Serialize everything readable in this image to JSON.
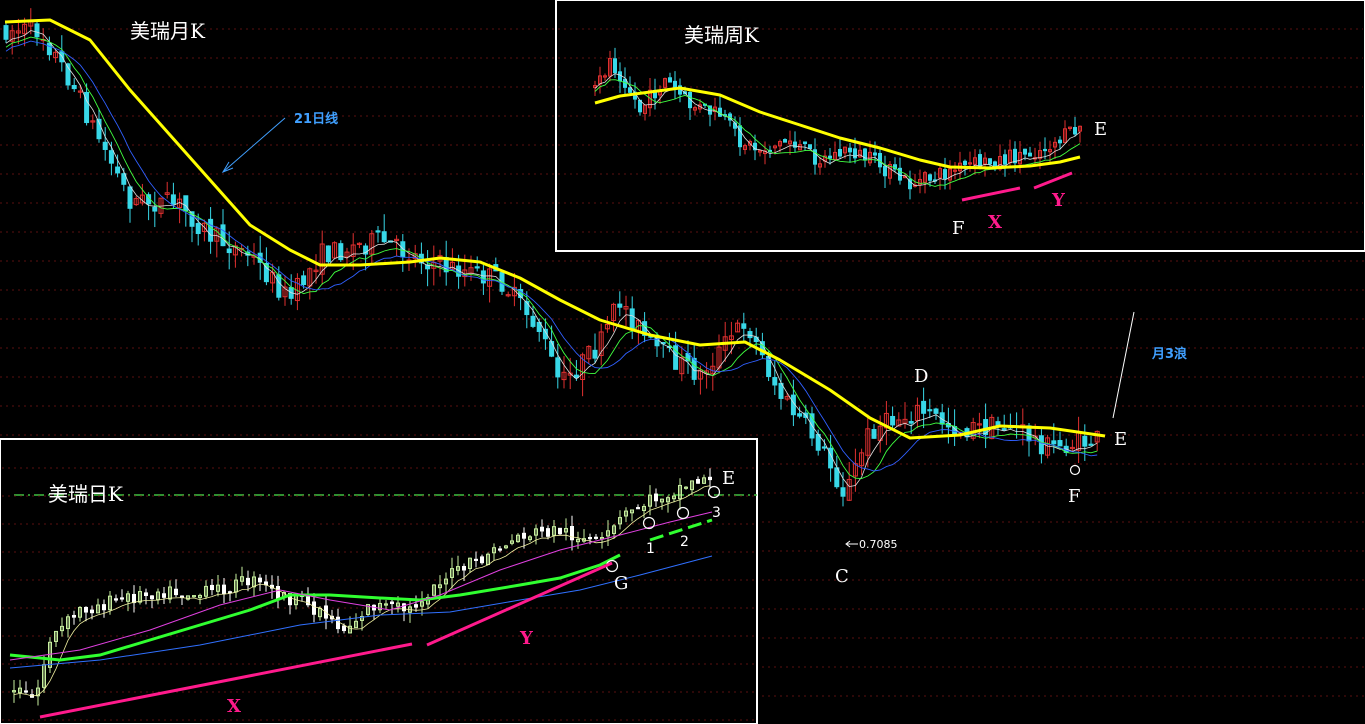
{
  "colors": {
    "background": "#000000",
    "grid": "#5a1010",
    "up": "#e03030",
    "down": "#38d8e8",
    "ma21": "#ffff00",
    "ma_fast": "#40ff40",
    "ma_mid": "#3060ff",
    "ma_white": "#e0e0e0",
    "daily_up": "#c8f0a0",
    "daily_ma_green": "#30ff30",
    "daily_ma_magenta": "#e040e0",
    "daily_ma_blue": "#3070ff",
    "trend_magenta": "#ff1a8c",
    "annotation_blue": "#40a0ff",
    "label_white": "#ffffff"
  },
  "chart_data": [
    {
      "type": "candlestick",
      "title": "美瑞月K",
      "series": [
        {
          "name": "21日线",
          "note": "21-period moving average (yellow)"
        }
      ],
      "annotations": [
        {
          "text": "21日线",
          "target": "ma21"
        },
        {
          "text": "月3浪"
        },
        {
          "text": "D"
        },
        {
          "text": "E"
        },
        {
          "text": "F"
        },
        {
          "text": "C"
        },
        {
          "text": "0.7085",
          "note": "low point"
        }
      ],
      "low": 0.7085
    },
    {
      "type": "candlestick",
      "title": "美瑞周K",
      "annotations": [
        {
          "text": "E"
        },
        {
          "text": "F"
        },
        {
          "text": "X"
        },
        {
          "text": "Y"
        }
      ]
    },
    {
      "type": "candlestick",
      "title": "美瑞日K",
      "annotations": [
        {
          "text": "E"
        },
        {
          "text": "G"
        },
        {
          "text": "1"
        },
        {
          "text": "2"
        },
        {
          "text": "3"
        },
        {
          "text": "X"
        },
        {
          "text": "Y"
        }
      ]
    }
  ]
}
